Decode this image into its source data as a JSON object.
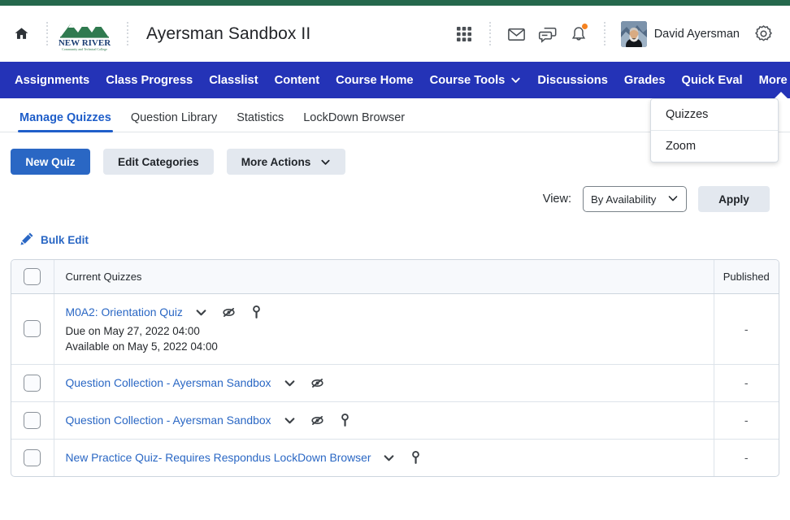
{
  "header": {
    "course_title": "Ayersman Sandbox II",
    "home_icon": "home-icon",
    "logo_line1": "NEW RIVER",
    "logo_line2": "Community and Technical College",
    "waffle_icon": "apps-grid-icon",
    "email_icon": "envelope-icon",
    "chat_icon": "chat-bubbles-icon",
    "alerts_icon": "bell-icon",
    "alerts_badge": "1",
    "user_name": "David Ayersman",
    "settings_icon": "gear-icon",
    "accent_green": "#25684c",
    "accent_badge": "#f58220"
  },
  "navbar": {
    "accent_blue": "#2433b7",
    "items": [
      {
        "label": "Assignments",
        "has_caret": false
      },
      {
        "label": "Class Progress",
        "has_caret": false
      },
      {
        "label": "Classlist",
        "has_caret": false
      },
      {
        "label": "Content",
        "has_caret": false
      },
      {
        "label": "Course Home",
        "has_caret": false
      },
      {
        "label": "Course Tools",
        "has_caret": true
      },
      {
        "label": "Discussions",
        "has_caret": false
      },
      {
        "label": "Grades",
        "has_caret": false
      },
      {
        "label": "Quick Eval",
        "has_caret": false
      },
      {
        "label": "More",
        "has_caret": true
      }
    ],
    "open_index": 9
  },
  "dropdown": {
    "items": [
      {
        "label": "Quizzes"
      },
      {
        "label": "Zoom"
      }
    ]
  },
  "subtabs": {
    "items": [
      {
        "label": "Manage Quizzes",
        "active": true
      },
      {
        "label": "Question Library",
        "active": false
      },
      {
        "label": "Statistics",
        "active": false
      },
      {
        "label": "LockDown Browser",
        "active": false
      }
    ]
  },
  "toolbar": {
    "new_quiz_label": "New Quiz",
    "edit_categories_label": "Edit Categories",
    "more_actions_label": "More Actions"
  },
  "viewbar": {
    "view_label": "View:",
    "select_value": "By Availability",
    "apply_label": "Apply"
  },
  "bulk_edit": {
    "label": "Bulk Edit",
    "icon": "pencil-icon"
  },
  "table": {
    "columns": {
      "quizzes": "Current Quizzes",
      "published": "Published"
    },
    "rows": [
      {
        "title": "M0A2: Orientation Quiz",
        "icons": [
          "eye-slash-icon",
          "key-icon"
        ],
        "due": "Due on May 27, 2022 04:00",
        "available": "Available on May 5, 2022 04:00",
        "published": "-"
      },
      {
        "title": "Question Collection - Ayersman Sandbox",
        "icons": [
          "eye-slash-icon"
        ],
        "due": "",
        "available": "",
        "published": "-"
      },
      {
        "title": "Question Collection - Ayersman Sandbox",
        "icons": [
          "eye-slash-icon",
          "key-icon"
        ],
        "due": "",
        "available": "",
        "published": "-"
      },
      {
        "title": "New Practice Quiz- Requires Respondus LockDown Browser",
        "icons": [
          "key-icon"
        ],
        "due": "",
        "available": "",
        "published": "-"
      }
    ]
  }
}
